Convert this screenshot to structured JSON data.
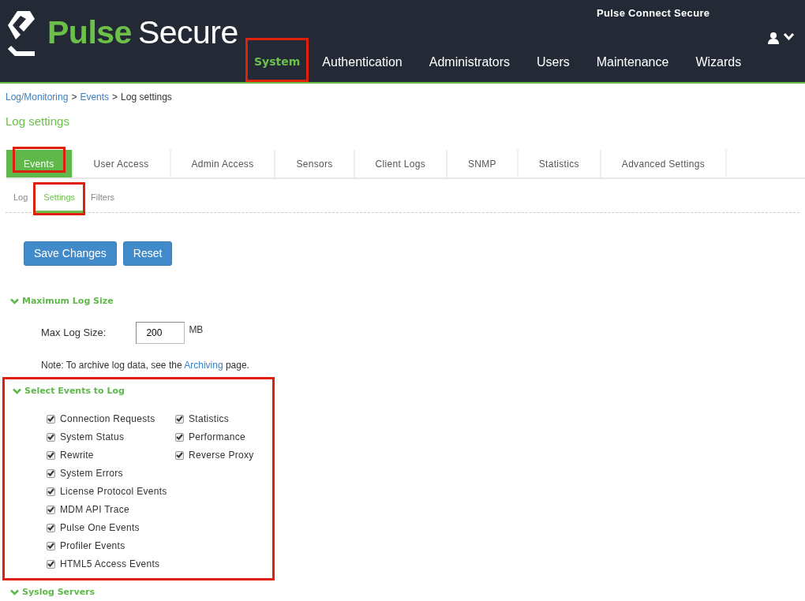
{
  "header": {
    "logo_words": [
      "Pulse",
      "Secure"
    ],
    "product": "Pulse Connect Secure",
    "nav": [
      {
        "label": "System",
        "selected": true,
        "highlighted": true
      },
      {
        "label": "Authentication",
        "selected": false,
        "highlighted": false
      },
      {
        "label": "Administrators",
        "selected": false,
        "highlighted": false
      },
      {
        "label": "Users",
        "selected": false,
        "highlighted": false
      },
      {
        "label": "Maintenance",
        "selected": false,
        "highlighted": false
      },
      {
        "label": "Wizards",
        "selected": false,
        "highlighted": false
      }
    ]
  },
  "breadcrumb": [
    {
      "label": "Log/Monitoring",
      "kind": "link"
    },
    {
      "label": ">",
      "kind": "sep"
    },
    {
      "label": "Events",
      "kind": "link"
    },
    {
      "label": ">",
      "kind": "sep"
    },
    {
      "label": "Log settings",
      "kind": "current"
    }
  ],
  "page_title": "Log settings",
  "tabs": [
    {
      "label": "Events",
      "selected": true,
      "highlighted": true
    },
    {
      "label": "User Access",
      "selected": false,
      "highlighted": false
    },
    {
      "label": "Admin Access",
      "selected": false,
      "highlighted": false
    },
    {
      "label": "Sensors",
      "selected": false,
      "highlighted": false
    },
    {
      "label": "Client Logs",
      "selected": false,
      "highlighted": false
    },
    {
      "label": "SNMP",
      "selected": false,
      "highlighted": false
    },
    {
      "label": "Statistics",
      "selected": false,
      "highlighted": false
    },
    {
      "label": "Advanced Settings",
      "selected": false,
      "highlighted": false
    }
  ],
  "subtabs": [
    {
      "label": "Log",
      "selected": false,
      "highlighted": false
    },
    {
      "label": "Settings",
      "selected": true,
      "highlighted": true
    },
    {
      "label": "Filters",
      "selected": false,
      "highlighted": false
    }
  ],
  "buttons": [
    "Save Changes",
    "Reset"
  ],
  "sections": [
    {
      "title": "Maximum Log Size",
      "expanded": true,
      "highlighted": false,
      "kind": "size",
      "label": "Max Log Size:",
      "value": "200",
      "unit": "MB",
      "note": "Note: To archive log data, see the",
      "note_link": "Archiving",
      "note_end": "page."
    },
    {
      "title": "Select Events to Log",
      "expanded": true,
      "highlighted": true,
      "kind": "checks",
      "columns": [
        [
          {
            "label": "Connection Requests",
            "checked": true
          },
          {
            "label": "System Status",
            "checked": true
          },
          {
            "label": "Rewrite",
            "checked": true
          },
          {
            "label": "System Errors",
            "checked": true
          },
          {
            "label": "License Protocol Events",
            "checked": true
          },
          {
            "label": "MDM API Trace",
            "checked": true
          },
          {
            "label": "Pulse One Events",
            "checked": true
          },
          {
            "label": "Profiler Events",
            "checked": true
          },
          {
            "label": "HTML5 Access Events",
            "checked": true
          }
        ],
        [
          {
            "label": "Statistics",
            "checked": true
          },
          {
            "label": "Performance",
            "checked": true
          },
          {
            "label": "Reverse Proxy",
            "checked": true
          }
        ]
      ]
    },
    {
      "title": "Syslog Servers",
      "expanded": true,
      "highlighted": false,
      "kind": "collapsed"
    }
  ]
}
